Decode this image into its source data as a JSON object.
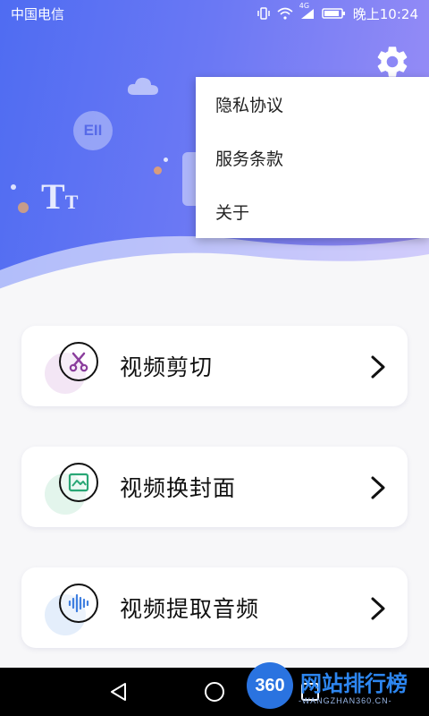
{
  "status_bar": {
    "carrier": "中国电信",
    "network": "4G",
    "time": "晚上10:24"
  },
  "header": {
    "settings_icon": "gear-icon"
  },
  "menu": {
    "items": [
      {
        "label": "隐私协议"
      },
      {
        "label": "服务条款"
      },
      {
        "label": "关于"
      }
    ]
  },
  "cards": [
    {
      "label": "视频剪切",
      "icon": "scissors-icon",
      "accent": "#f3e6f5"
    },
    {
      "label": "视频换封面",
      "icon": "image-icon",
      "accent": "#e3f5ec"
    },
    {
      "label": "视频提取音频",
      "icon": "audio-wave-icon",
      "accent": "#e4eefb"
    }
  ],
  "nav": {
    "back_icon": "back-triangle-icon",
    "home_icon": "home-circle-icon",
    "recents_icon": "recents-square-icon"
  },
  "watermark": {
    "badge": "360",
    "title": "网站排行榜",
    "subtitle": "-WANGZHAN360.CN-"
  },
  "colors": {
    "gradient_start": "#4f6cf2",
    "gradient_end": "#9a8ef6",
    "card_bg": "#ffffff",
    "page_bg": "#f7f7f9"
  }
}
